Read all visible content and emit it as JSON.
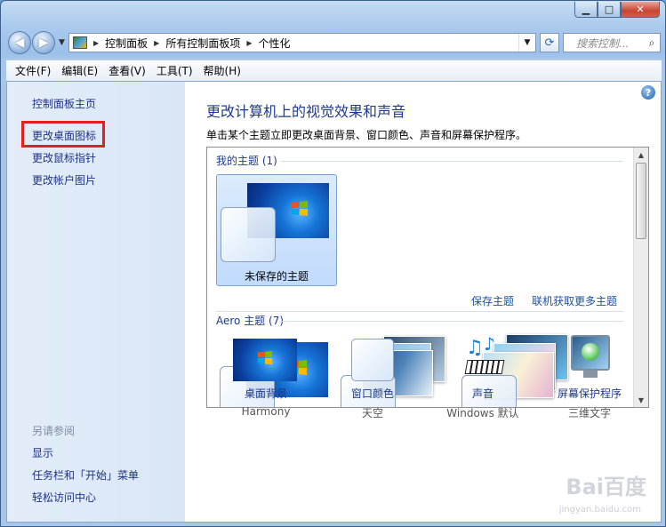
{
  "window": {
    "controls": {
      "minimize": "▁",
      "maximize": "□",
      "close": "✕"
    }
  },
  "nav": {
    "back_icon": "back-arrow-icon",
    "forward_icon": "forward-arrow-icon",
    "breadcrumbs": [
      "控制面板",
      "所有控制面板项",
      "个性化"
    ],
    "search_placeholder": "搜索控制..."
  },
  "menu": [
    "文件(F)",
    "编辑(E)",
    "查看(V)",
    "工具(T)",
    "帮助(H)"
  ],
  "sidebar": {
    "items": [
      "控制面板主页",
      "更改桌面图标",
      "更改鼠标指针",
      "更改帐户图片"
    ],
    "see_also_heading": "另请参阅",
    "see_also": [
      "显示",
      "任务栏和「开始」菜单",
      "轻松访问中心"
    ],
    "highlight_color": "#e0221f"
  },
  "main": {
    "help": "?",
    "title": "更改计算机上的视觉效果和声音",
    "subtitle": "单击某个主题立即更改桌面背景、窗口颜色、声音和屏幕保护程序。",
    "my_themes_heading": "我的主题 (1)",
    "unsaved_theme": "未保存的主题",
    "save_theme": "保存主题",
    "get_more": "联机获取更多主题",
    "aero_heading": "Aero 主题 (7)"
  },
  "bottom": [
    {
      "label": "桌面背景",
      "value": "Harmony"
    },
    {
      "label": "窗口颜色",
      "value": "天空"
    },
    {
      "label": "声音",
      "value": "Windows 默认"
    },
    {
      "label": "屏幕保护程序",
      "value": "三维文字"
    }
  ],
  "watermark": {
    "main": "Bai百度",
    "sub": "jingyan.baidu.com"
  }
}
